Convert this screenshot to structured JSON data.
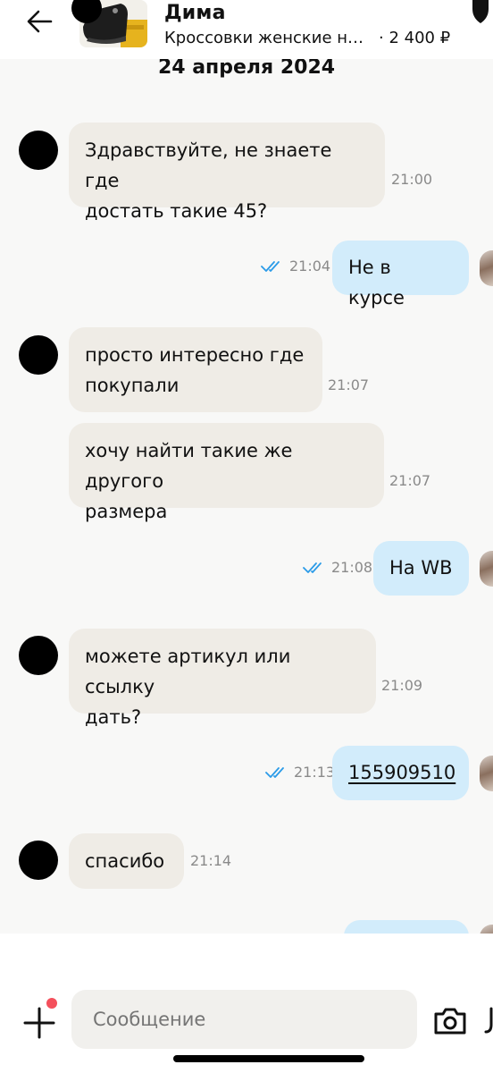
{
  "header": {
    "seller_name": "Дима",
    "product_title": "Кроссовки женские на...",
    "price": "· 2 400 ₽"
  },
  "chat": {
    "date": "24 апреля 2024",
    "messages": [
      {
        "dir": "in",
        "lines": [
          "Здравствуйте, не знаете где",
          "достать такие 45?"
        ],
        "time": "21:00"
      },
      {
        "dir": "out",
        "text": "Не в курсе",
        "time": "21:04",
        "status": "read"
      },
      {
        "dir": "in",
        "lines": [
          "просто интересно где",
          "покупали"
        ],
        "time": "21:07"
      },
      {
        "dir": "in",
        "lines": [
          "хочу найти такие же другого",
          "размера"
        ],
        "time": "21:07"
      },
      {
        "dir": "out",
        "text": "На WB",
        "time": "21:08",
        "status": "read"
      },
      {
        "dir": "in",
        "lines": [
          "можете артикул или ссылку",
          "дать?"
        ],
        "time": "21:09"
      },
      {
        "dir": "out",
        "text": "155909510",
        "time": "21:13",
        "status": "read",
        "is_link": true
      },
      {
        "dir": "in",
        "lines": [
          "спасибо"
        ],
        "time": "21:14"
      }
    ]
  },
  "input": {
    "placeholder": "Сообщение"
  },
  "colors": {
    "incoming_bubble": "#efece6",
    "outgoing_bubble": "#d2ecfb",
    "read_check": "#2b9be8",
    "notification_dot": "#f4505c"
  }
}
